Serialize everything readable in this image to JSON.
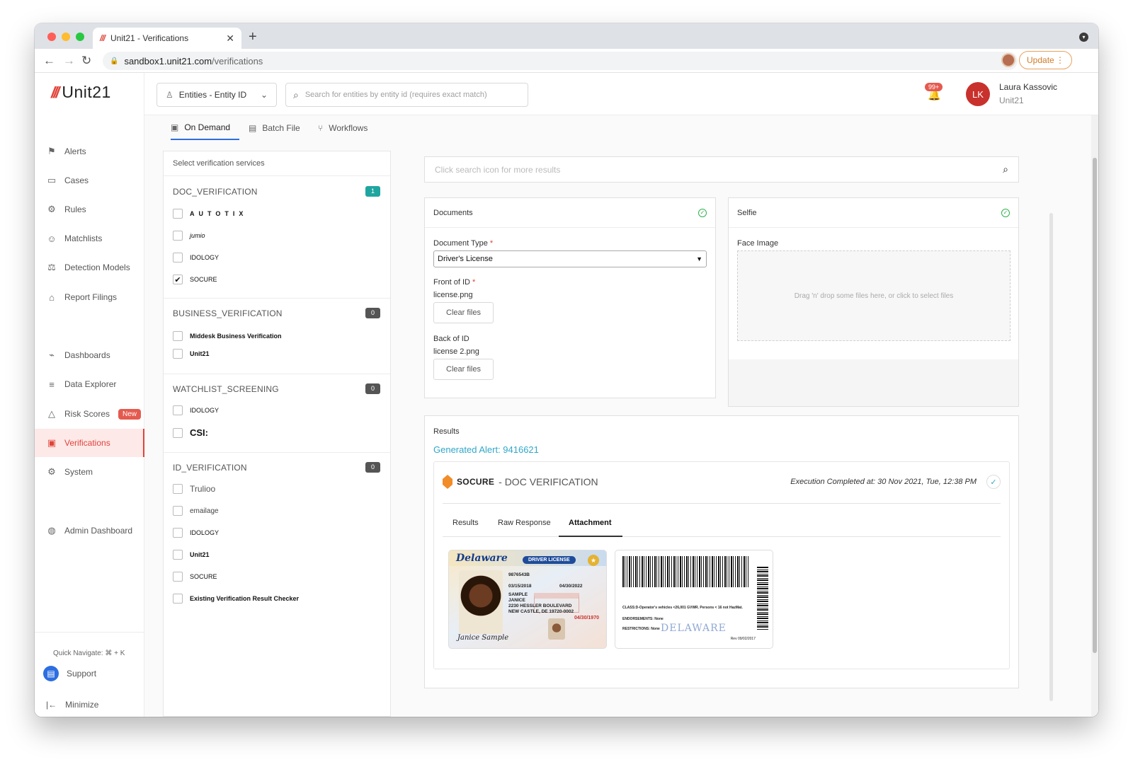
{
  "browser": {
    "tab_title": "Unit21 - Verifications",
    "tab_favicon": "///",
    "url_host": "sandbox1.unit21.com",
    "url_path": "/verifications",
    "update_label": "Update"
  },
  "app": {
    "logo_slashes": "///",
    "logo_text": "Unit21"
  },
  "sidebar": {
    "items": [
      {
        "label": "Alerts",
        "icon": "flag-icon"
      },
      {
        "label": "Cases",
        "icon": "briefcase-icon"
      },
      {
        "label": "Rules",
        "icon": "rules-icon"
      },
      {
        "label": "Matchlists",
        "icon": "user-list-icon"
      },
      {
        "label": "Detection Models",
        "icon": "scale-icon"
      },
      {
        "label": "Report Filings",
        "icon": "bank-icon"
      },
      {
        "label": "Dashboards",
        "icon": "chart-icon"
      },
      {
        "label": "Data Explorer",
        "icon": "data-search-icon"
      },
      {
        "label": "Risk Scores",
        "icon": "warning-icon",
        "badge": "New"
      },
      {
        "label": "Verifications",
        "icon": "id-card-icon",
        "active": true
      },
      {
        "label": "System",
        "icon": "gear-icon"
      },
      {
        "label": "Admin Dashboard",
        "icon": "globe-icon"
      }
    ],
    "quick_navigate": "Quick Navigate: ⌘ + K",
    "support": "Support",
    "minimize": "Minimize"
  },
  "header": {
    "entity_selector": "Entities - Entity ID",
    "search_placeholder": "Search for entities by entity id (requires exact match)",
    "notifications_badge": "99+",
    "user_initials": "LK",
    "user_name": "Laura Kassovic",
    "user_org": "Unit21"
  },
  "page_tabs": [
    {
      "label": "On Demand",
      "active": true
    },
    {
      "label": "Batch File",
      "active": false
    },
    {
      "label": "Workflows",
      "active": false
    }
  ],
  "services": {
    "heading": "Select verification services",
    "sections": [
      {
        "title": "DOC_VERIFICATION",
        "count": "1",
        "count_color": "#1fa5a0",
        "items": [
          {
            "label": "AUTOTIX",
            "checked": false
          },
          {
            "label": "jumio",
            "checked": false
          },
          {
            "label": "IDOLOGY",
            "checked": false
          },
          {
            "label": "SOCURE",
            "checked": true
          }
        ]
      },
      {
        "title": "BUSINESS_VERIFICATION",
        "count": "0",
        "count_color": "#555555",
        "items": [
          {
            "label": "Middesk Business Verification",
            "checked": false
          },
          {
            "label": "Unit21",
            "checked": false
          }
        ]
      },
      {
        "title": "WATCHLIST_SCREENING",
        "count": "0",
        "count_color": "#555555",
        "items": [
          {
            "label": "IDOLOGY",
            "checked": false
          },
          {
            "label": "CSI:",
            "checked": false
          }
        ]
      },
      {
        "title": "ID_VERIFICATION",
        "count": "0",
        "count_color": "#555555",
        "items": [
          {
            "label": "Trulioo",
            "checked": false
          },
          {
            "label": "emailage",
            "checked": false
          },
          {
            "label": "IDOLOGY",
            "checked": false
          },
          {
            "label": "Unit21",
            "checked": false
          },
          {
            "label": "SOCURE",
            "checked": false
          },
          {
            "label": "Existing Verification Result Checker",
            "checked": false
          }
        ]
      }
    ]
  },
  "results_search": {
    "placeholder": "Click search icon for more results"
  },
  "documents": {
    "title": "Documents",
    "doc_type_label": "Document Type",
    "doc_type_value": "Driver's License",
    "front_label": "Front of ID",
    "front_file": "license.png",
    "back_label": "Back of ID",
    "back_file": "license 2.png",
    "clear_label": "Clear files"
  },
  "selfie": {
    "title": "Selfie",
    "face_label": "Face Image",
    "drop_text": "Drag 'n' drop some files here, or click to select files"
  },
  "results": {
    "title": "Results",
    "alert_link": "Generated Alert: 9416621",
    "vendor": "SOCURE",
    "vendor_sub": "- DOC VERIFICATION",
    "execution": "Execution Completed at: 30 Nov 2021, Tue, 12:38 PM",
    "tabs": [
      "Results",
      "Raw Response",
      "Attachment"
    ],
    "active_tab": "Attachment"
  },
  "license_front": {
    "state": "Delaware",
    "type": "DRIVER LICENSE",
    "number": "9876543B",
    "issued": "03/15/2018",
    "expires": "04/30/2022",
    "name1": "SAMPLE",
    "name2": "JANICE",
    "address1": "2230 HESSLER BOULEVARD",
    "address2": "NEW CASTLE, DE 19720-0002",
    "dob": "04/30/1970",
    "signature": "Janice Sample"
  },
  "license_back": {
    "line1": "CLASS:D-Operator's vehicles <26,001 GVWR. Persons < 16 not HazMat.",
    "line2": "ENDORSEMENTS: None",
    "line3": "RESTRICTIONS: None",
    "watermark": "DELAWARE",
    "issued": "Rev 09/02/2017"
  }
}
